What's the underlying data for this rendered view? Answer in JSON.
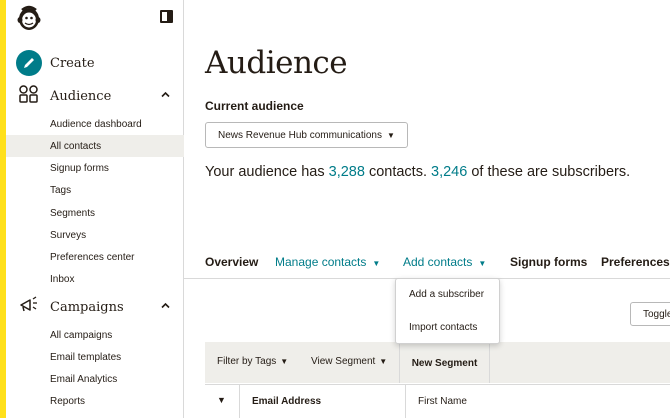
{
  "sidebar": {
    "create_label": "Create",
    "audience": {
      "label": "Audience",
      "items": [
        {
          "label": "Audience dashboard"
        },
        {
          "label": "All contacts"
        },
        {
          "label": "Signup forms"
        },
        {
          "label": "Tags"
        },
        {
          "label": "Segments"
        },
        {
          "label": "Surveys"
        },
        {
          "label": "Preferences center"
        },
        {
          "label": "Inbox"
        }
      ]
    },
    "campaigns": {
      "label": "Campaigns",
      "items": [
        {
          "label": "All campaigns"
        },
        {
          "label": "Email templates"
        },
        {
          "label": "Email Analytics"
        },
        {
          "label": "Reports"
        }
      ]
    }
  },
  "main": {
    "title": "Audience",
    "current_audience_label": "Current audience",
    "audience_select": "News Revenue Hub communications",
    "summary": {
      "prefix": "Your audience has ",
      "contacts": "3,288",
      "middle": " contacts. ",
      "subscribers": "3,246",
      "suffix": " of these are subscribers."
    },
    "tabs": {
      "overview": "Overview",
      "manage": "Manage contacts",
      "add": "Add contacts",
      "signup": "Signup forms",
      "preferences": "Preferences c"
    },
    "add_menu": {
      "add_subscriber": "Add a subscriber",
      "import_contacts": "Import contacts"
    },
    "toggle_label": "Toggle",
    "filters": {
      "by_tags": "Filter by Tags",
      "view_segment": "View Segment",
      "new_segment": "New Segment"
    },
    "table": {
      "columns": [
        "Email Address",
        "First Name"
      ]
    }
  },
  "colors": {
    "accent_yellow": "#ffe01b",
    "teal": "#007c89",
    "text": "#241c15",
    "active_bg": "#efeeea"
  },
  "icons": {
    "logo": "mailchimp-logo",
    "create": "pencil-icon",
    "audience": "audience-icon",
    "campaigns": "megaphone-icon",
    "collapse": "sidebar-toggle-icon"
  }
}
